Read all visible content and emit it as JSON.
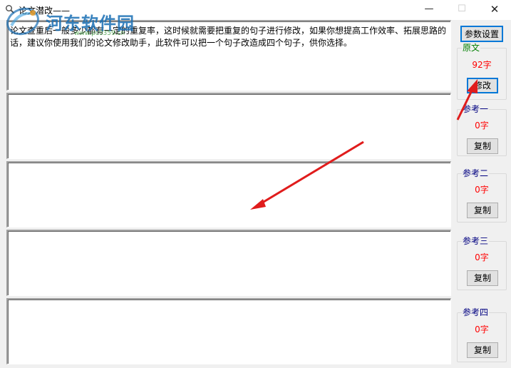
{
  "window": {
    "title": "论文潜改——",
    "controls": {
      "minimize": "—",
      "maximize": "☐",
      "close": "✕"
    }
  },
  "watermark": {
    "text": "河东软件园",
    "sub_text": "www.pc0359.cn"
  },
  "settings_button": "参数设置",
  "text_areas": [
    {
      "value": "论文查重后一般多少都有一定的重复率，这时候就需要把重复的句子进行修改，如果你想提高工作效率、拓展思路的话，建议你使用我们的论文修改助手，此软件可以把一个句子改造成四个句子，供你选择。"
    },
    {
      "value": ""
    },
    {
      "value": ""
    },
    {
      "value": ""
    },
    {
      "value": ""
    }
  ],
  "groups": [
    {
      "label": "原文",
      "count": "92字",
      "button": "修改"
    },
    {
      "label": "参考一",
      "count": "0字",
      "button": "复制"
    },
    {
      "label": "参考二",
      "count": "0字",
      "button": "复制"
    },
    {
      "label": "参考三",
      "count": "0字",
      "button": "复制"
    },
    {
      "label": "参考四",
      "count": "0字",
      "button": "复制"
    }
  ],
  "colors": {
    "count_text": "#ff0000",
    "original_label": "#008000",
    "reference_label": "#000080",
    "annotation_arrow": "#e01c1c",
    "focus_border": "#0078d7"
  }
}
